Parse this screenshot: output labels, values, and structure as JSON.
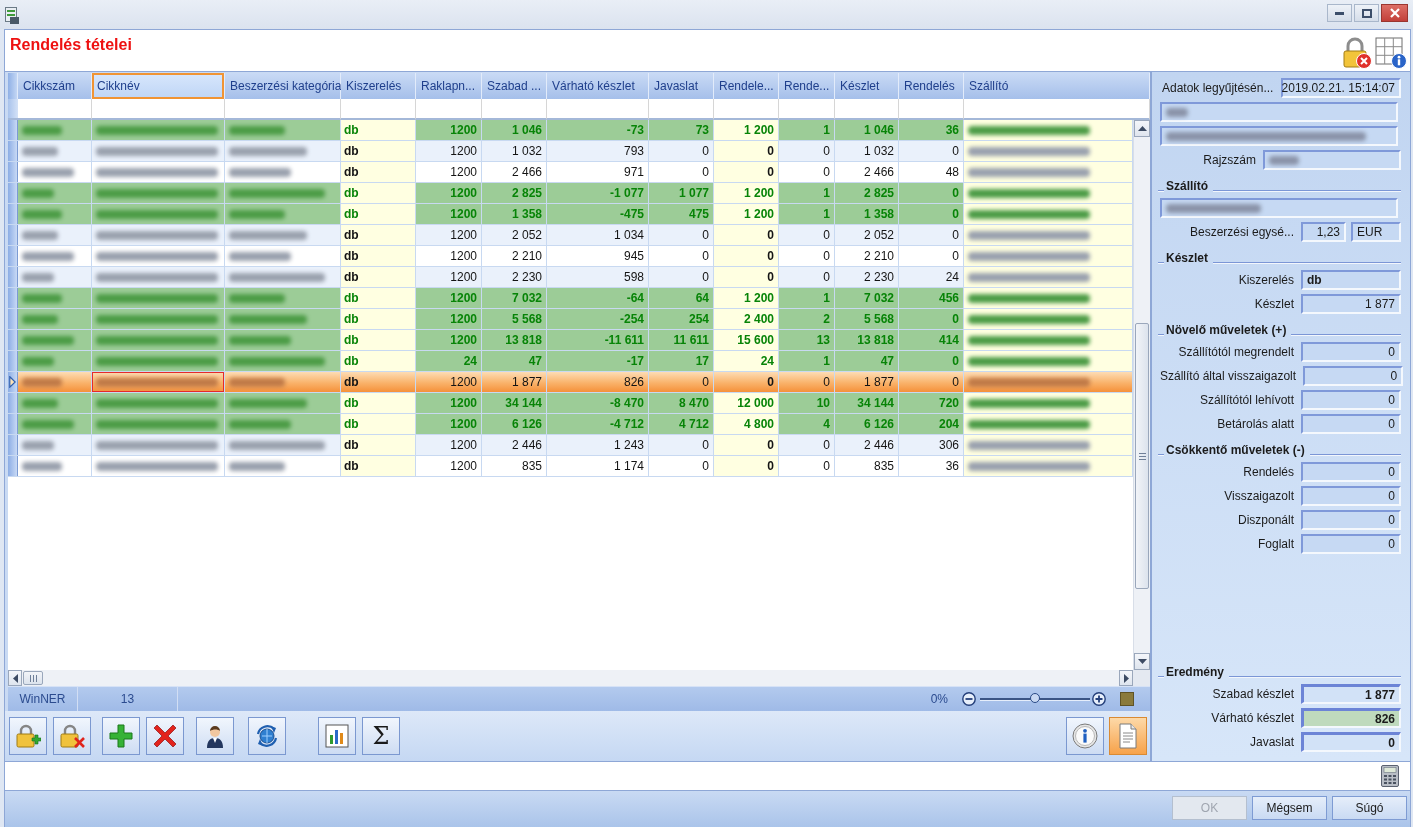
{
  "header": {
    "title": "Rendelés tételei"
  },
  "table": {
    "columns": [
      {
        "label": "Cikkszám",
        "kind": "code",
        "focused": false
      },
      {
        "label": "Cikknév",
        "kind": "name",
        "focused": true
      },
      {
        "label": "Beszerzési kategória",
        "kind": "category",
        "focused": false
      },
      {
        "label": "Kiszerelés",
        "kind": "unit",
        "focused": false
      },
      {
        "label": "Raklapn...",
        "kind": "number",
        "focused": false
      },
      {
        "label": "Szabad ...",
        "kind": "number",
        "focused": false
      },
      {
        "label": "Várható készlet",
        "kind": "number",
        "focused": false
      },
      {
        "label": "Javaslat",
        "kind": "number",
        "focused": false
      },
      {
        "label": "Rendele...",
        "kind": "order",
        "focused": false
      },
      {
        "label": "Rende...",
        "kind": "number",
        "focused": false
      },
      {
        "label": "Készlet",
        "kind": "number",
        "focused": false
      },
      {
        "label": "Rendelés",
        "kind": "number",
        "focused": false
      },
      {
        "label": "Szállító",
        "kind": "supplier",
        "focused": false
      }
    ],
    "rows": [
      {
        "highlighted": true,
        "selected": false,
        "cells": [
          "",
          "",
          "",
          "db",
          "1200",
          "1 046",
          "-73",
          "73",
          "1 200",
          "1",
          "1 046",
          "36",
          ""
        ]
      },
      {
        "highlighted": false,
        "selected": false,
        "cells": [
          "",
          "",
          "",
          "db",
          "1200",
          "1 032",
          "793",
          "0",
          "0",
          "0",
          "1 032",
          "0",
          ""
        ]
      },
      {
        "highlighted": false,
        "selected": false,
        "cells": [
          "",
          "",
          "",
          "db",
          "1200",
          "2 466",
          "971",
          "0",
          "0",
          "0",
          "2 466",
          "48",
          ""
        ]
      },
      {
        "highlighted": true,
        "selected": false,
        "cells": [
          "",
          "",
          "",
          "db",
          "1200",
          "2 825",
          "-1 077",
          "1 077",
          "1 200",
          "1",
          "2 825",
          "0",
          ""
        ]
      },
      {
        "highlighted": true,
        "selected": false,
        "cells": [
          "",
          "",
          "",
          "db",
          "1200",
          "1 358",
          "-475",
          "475",
          "1 200",
          "1",
          "1 358",
          "0",
          ""
        ]
      },
      {
        "highlighted": false,
        "selected": false,
        "cells": [
          "",
          "",
          "",
          "db",
          "1200",
          "2 052",
          "1 034",
          "0",
          "0",
          "0",
          "2 052",
          "0",
          ""
        ]
      },
      {
        "highlighted": false,
        "selected": false,
        "cells": [
          "",
          "",
          "",
          "db",
          "1200",
          "2 210",
          "945",
          "0",
          "0",
          "0",
          "2 210",
          "0",
          ""
        ]
      },
      {
        "highlighted": false,
        "selected": false,
        "cells": [
          "",
          "",
          "",
          "db",
          "1200",
          "2 230",
          "598",
          "0",
          "0",
          "0",
          "2 230",
          "24",
          ""
        ]
      },
      {
        "highlighted": true,
        "selected": false,
        "cells": [
          "",
          "",
          "",
          "db",
          "1200",
          "7 032",
          "-64",
          "64",
          "1 200",
          "1",
          "7 032",
          "456",
          ""
        ]
      },
      {
        "highlighted": true,
        "selected": false,
        "cells": [
          "",
          "",
          "",
          "db",
          "1200",
          "5 568",
          "-254",
          "254",
          "2 400",
          "2",
          "5 568",
          "0",
          ""
        ]
      },
      {
        "highlighted": true,
        "selected": false,
        "cells": [
          "",
          "",
          "",
          "db",
          "1200",
          "13 818",
          "-11 611",
          "11 611",
          "15 600",
          "13",
          "13 818",
          "414",
          ""
        ]
      },
      {
        "highlighted": true,
        "selected": false,
        "cells": [
          "",
          "",
          "",
          "db",
          "24",
          "47",
          "-17",
          "17",
          "24",
          "1",
          "47",
          "0",
          ""
        ]
      },
      {
        "highlighted": false,
        "selected": true,
        "cells": [
          "",
          "",
          "",
          "db",
          "1200",
          "1 877",
          "826",
          "0",
          "0",
          "0",
          "1 877",
          "0",
          ""
        ]
      },
      {
        "highlighted": true,
        "selected": false,
        "cells": [
          "",
          "",
          "",
          "db",
          "1200",
          "34 144",
          "-8 470",
          "8 470",
          "12 000",
          "10",
          "34 144",
          "720",
          ""
        ]
      },
      {
        "highlighted": true,
        "selected": false,
        "cells": [
          "",
          "",
          "",
          "db",
          "1200",
          "6 126",
          "-4 712",
          "4 712",
          "4 800",
          "4",
          "6 126",
          "204",
          ""
        ]
      },
      {
        "highlighted": false,
        "selected": false,
        "cells": [
          "",
          "",
          "",
          "db",
          "1200",
          "2 446",
          "1 243",
          "0",
          "0",
          "0",
          "2 446",
          "306",
          ""
        ]
      },
      {
        "highlighted": false,
        "selected": false,
        "cells": [
          "",
          "",
          "",
          "db",
          "1200",
          "835",
          "1 174",
          "0",
          "0",
          "0",
          "835",
          "36",
          ""
        ]
      }
    ]
  },
  "status_bar": {
    "product": "WinNER",
    "count": "13",
    "zoom": {
      "reading": "0%",
      "level": 0.5
    }
  },
  "toolbar": {
    "sum_button": {
      "label": "Σ"
    },
    "document_button": {
      "pressed": true
    }
  },
  "details": {
    "collected": {
      "label": "Adatok legyűjtésén...",
      "value": "2019.02.21. 15:14:07"
    },
    "drawing_number": {
      "label": "Rajzszám"
    },
    "supplier": {
      "title": "Szállító",
      "unit_price": {
        "label": "Beszerzési egysé...",
        "value": "1,23",
        "currency": "EUR"
      }
    },
    "stock": {
      "title": "Készlet",
      "fields": [
        {
          "label": "Kiszerelés",
          "value": "db",
          "kind": "unit"
        },
        {
          "label": "Készlet",
          "value": "1 877",
          "kind": "number"
        }
      ]
    },
    "increasing": {
      "title": "Növelő műveletek (+)",
      "fields": [
        {
          "label": "Szállítótól megrendelt",
          "value": "0"
        },
        {
          "label": "Szállító által visszaigazolt",
          "value": "0"
        },
        {
          "label": "Szállítótól lehívott",
          "value": "0"
        },
        {
          "label": "Betárolás alatt",
          "value": "0"
        }
      ]
    },
    "decreasing": {
      "title": "Csökkentő műveletek (-)",
      "fields": [
        {
          "label": "Rendelés",
          "value": "0"
        },
        {
          "label": "Visszaigazolt",
          "value": "0"
        },
        {
          "label": "Diszponált",
          "value": "0"
        },
        {
          "label": "Foglalt",
          "value": "0"
        }
      ]
    },
    "result": {
      "title": "Eredmény",
      "fields": [
        {
          "label": "Szabad készlet",
          "value": "1 877",
          "highlighted": false
        },
        {
          "label": "Várható készlet",
          "value": "826",
          "highlighted": true
        },
        {
          "label": "Javaslat",
          "value": "0",
          "highlighted": false
        }
      ]
    }
  },
  "buttons": [
    {
      "label": "OK",
      "disabled": true
    },
    {
      "label": "Mégsem",
      "disabled": false
    },
    {
      "label": "Súgó",
      "disabled": false
    }
  ]
}
